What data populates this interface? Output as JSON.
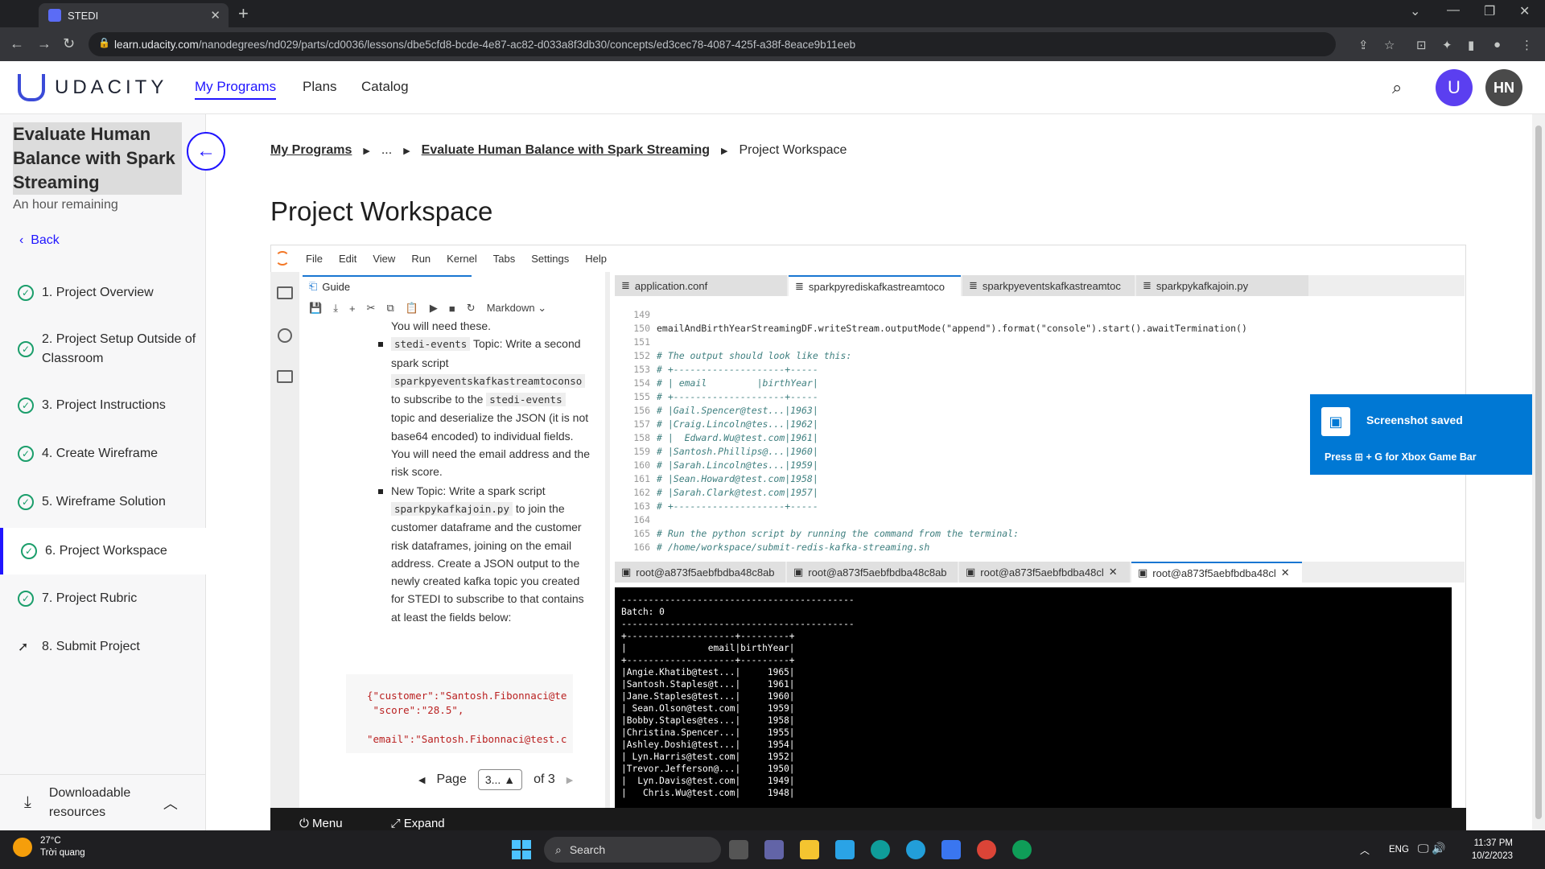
{
  "browser": {
    "tab_title": "STEDI",
    "url_host": "learn.udacity.com",
    "url_path": "/nanodegrees/nd029/parts/cd0036/lessons/dbe5cfd8-bcde-4e87-ac82-d033a8f3db30/concepts/ed3cec78-4087-425f-a38f-8eace9b11eeb"
  },
  "header": {
    "brand": "UDACITY",
    "nav": [
      "My Programs",
      "Plans",
      "Catalog"
    ],
    "user_initials": "HN"
  },
  "sidebar": {
    "course_title": "Evaluate Human Balance with Spark Streaming",
    "remaining": "An hour remaining",
    "back": "Back",
    "lessons": [
      "1. Project Overview",
      "2. Project Setup Outside of Classroom",
      "3. Project Instructions",
      "4. Create Wireframe",
      "5. Wireframe Solution",
      "6. Project Workspace",
      "7. Project Rubric",
      "8. Submit Project"
    ],
    "downloadable": "Downloadable resources"
  },
  "breadcrumb": {
    "root": "My Programs",
    "ellipsis": "...",
    "course": "Evaluate Human Balance with Spark Streaming",
    "current": "Project Workspace"
  },
  "page_title": "Project Workspace",
  "jupyter": {
    "menu": [
      "File",
      "Edit",
      "View",
      "Run",
      "Kernel",
      "Tabs",
      "Settings",
      "Help"
    ],
    "guide_tab": "Guide",
    "cell_type": "Markdown",
    "guide": {
      "lead": "You will need these.",
      "b1_pre": "Topic: Write a second spark script",
      "b1_code1": "stedi-events",
      "b1_code2": "sparkpyeventskafkastreamtoconso",
      "b1_mid": "to subscribe to the",
      "b1_code3": "stedi-events",
      "b1_post": "topic and deserialize the JSON (it is not base64 encoded) to individual fields. You will need the email address and the risk score.",
      "b2_pre": "New Topic: Write a spark script",
      "b2_code": "sparkpykafkajoin.py",
      "b2_post": "to join the customer dataframe and the customer risk dataframes, joining on the email address. Create a JSON output to the newly created kafka topic you created for STEDI to subscribe to that contains at least the fields below:",
      "code": "{\"customer\":\"Santosh.Fibonnaci@te\n \"score\":\"28.5\",\n\n\"email\":\"Santosh.Fibonnaci@test.c"
    },
    "pager": {
      "label": "Page",
      "value": "3...",
      "of": "of 3"
    },
    "editor_tabs": [
      "application.conf",
      "sparkpyrediskafkastreamtoco",
      "sparkpyeventskafkastreamtoc",
      "sparkpykafkajoin.py"
    ],
    "editor_lines": [
      {
        "n": "149",
        "t": ""
      },
      {
        "n": "150",
        "t": "emailAndBirthYearStreamingDF.writeStream.outputMode(\"append\").format(\"console\").start().awaitTermination()"
      },
      {
        "n": "151",
        "t": ""
      },
      {
        "n": "152",
        "t": "# The output should look like this:"
      },
      {
        "n": "153",
        "t": "# +--------------------+-----"
      },
      {
        "n": "154",
        "t": "# | email         |birthYear|"
      },
      {
        "n": "155",
        "t": "# +--------------------+-----"
      },
      {
        "n": "156",
        "t": "# |Gail.Spencer@test...|1963|"
      },
      {
        "n": "157",
        "t": "# |Craig.Lincoln@tes...|1962|"
      },
      {
        "n": "158",
        "t": "# |  Edward.Wu@test.com|1961|"
      },
      {
        "n": "159",
        "t": "# |Santosh.Phillips@...|1960|"
      },
      {
        "n": "160",
        "t": "# |Sarah.Lincoln@tes...|1959|"
      },
      {
        "n": "161",
        "t": "# |Sean.Howard@test.com|1958|"
      },
      {
        "n": "162",
        "t": "# |Sarah.Clark@test.com|1957|"
      },
      {
        "n": "163",
        "t": "# +--------------------+-----"
      },
      {
        "n": "164",
        "t": ""
      },
      {
        "n": "165",
        "t": "# Run the python script by running the command from the terminal:"
      },
      {
        "n": "166",
        "t": "# /home/workspace/submit-redis-kafka-streaming.sh"
      }
    ],
    "terminal_tabs": [
      "root@a873f5aebfbdba48c8ab",
      "root@a873f5aebfbdba48c8ab",
      "root@a873f5aebfbdba48cl",
      "root@a873f5aebfbdba48cl"
    ],
    "terminal_text": "-------------------------------------------\nBatch: 0\n-------------------------------------------\n+--------------------+---------+\n|               email|birthYear|\n+--------------------+---------+\n|Angie.Khatib@test...|     1965|\n|Santosh.Staples@t...|     1961|\n|Jane.Staples@test...|     1960|\n| Sean.Olson@test.com|     1959|\n|Bobby.Staples@tes...|     1958|\n|Christina.Spencer...|     1955|\n|Ashley.Doshi@test...|     1954|\n| Lyn.Harris@test.com|     1952|\n|Trevor.Jefferson@...|     1950|\n|  Lyn.Davis@test.com|     1949|\n|   Chris.Wu@test.com|     1948|",
    "footer": [
      "Menu",
      "Expand"
    ]
  },
  "toast": {
    "title": "Screenshot saved",
    "subtitle": "Press ⊞ + G for Xbox Game Bar"
  },
  "taskbar": {
    "temp": "27°C",
    "weather": "Trời quang",
    "search": "Search",
    "lang": "ENG",
    "time": "11:37 PM",
    "date": "10/2/2023"
  },
  "colors": {
    "accent": "#2015ff",
    "check": "#1b9e6b",
    "toast": "#0078d4"
  }
}
